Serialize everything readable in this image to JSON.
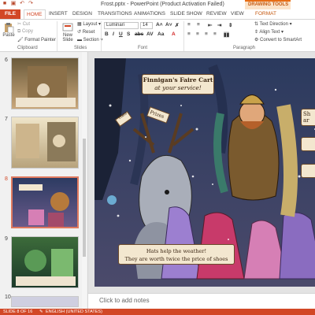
{
  "window": {
    "title": "Frost.pptx - PowerPoint (Product Activation Failed)",
    "contextual_tab_group": "DRAWING TOOLS"
  },
  "tabs": [
    "FILE",
    "HOME",
    "INSERT",
    "DESIGN",
    "TRANSITIONS",
    "ANIMATIONS",
    "SLIDE SHOW",
    "REVIEW",
    "VIEW",
    "FORMAT"
  ],
  "ribbon": {
    "clipboard": {
      "paste": "Paste",
      "cut": "Cut",
      "copy": "Copy",
      "format_painter": "Format Painter",
      "label": "Clipboard"
    },
    "slides": {
      "new_slide": "New Slide",
      "layout": "Layout",
      "reset": "Reset",
      "section": "Section",
      "label": "Slides"
    },
    "font": {
      "name": "Luminari",
      "size": "14",
      "label": "Font"
    },
    "paragraph": {
      "text_direction": "Text Direction",
      "align_text": "Align Text",
      "smartart": "Convert to SmartArt",
      "label": "Paragraph"
    }
  },
  "thumbnails": [
    {
      "num": "6",
      "selected": false
    },
    {
      "num": "7",
      "selected": false
    },
    {
      "num": "8",
      "selected": true
    },
    {
      "num": "9",
      "selected": false
    },
    {
      "num": "10",
      "selected": false
    }
  ],
  "slide": {
    "banner_line1": "Finnigan's Faire Cart",
    "banner_line2": "at your service!",
    "prizes": "Prizes",
    "sign_left": "Hats",
    "side_text_1": "Sh",
    "side_text_2": "ar",
    "caption_line1": "Hats help the weather!",
    "caption_line2": "They are worth twice the price of shoes"
  },
  "notes": {
    "placeholder": "Click to add notes"
  },
  "status": {
    "slide": "SLIDE 8 OF 16",
    "language": "ENGLISH (UNITED STATES)"
  }
}
